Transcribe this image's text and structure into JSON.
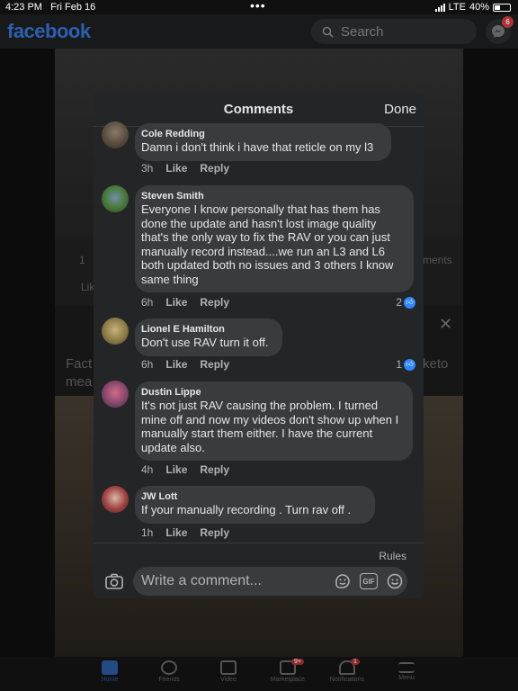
{
  "status_bar": {
    "time": "4:23 PM",
    "date": "Fri Feb 16",
    "carrier": "LTE",
    "battery": "40%",
    "battery_level": 0.4
  },
  "header": {
    "logo": "facebook",
    "search_placeholder": "Search",
    "messenger_badge": "6"
  },
  "background": {
    "snippet_1": "Fact",
    "snippet_2": "mea",
    "snippet_3": "keto",
    "snippet_4": "ments",
    "snippet_5": "Lik",
    "reaction_count": "1"
  },
  "modal": {
    "title": "Comments",
    "done_label": "Done",
    "comments": [
      {
        "name": "Cole Redding",
        "text": "Damn i don't think i have that reticle on my l3",
        "time": "3h",
        "like": "Like",
        "reply": "Reply",
        "reactions": ""
      },
      {
        "name": "Steven Smith",
        "text": "Everyone I know personally that has them has done the update and hasn't lost image quality that's the only way to fix the RAV or you can just manually record instead....we run an L3 and L6 both updated both no issues and 3 others I know same thing",
        "time": "6h",
        "like": "Like",
        "reply": "Reply",
        "reactions": "2"
      },
      {
        "name": "Lionel E Hamilton",
        "text": "Don't use RAV turn it off.",
        "time": "6h",
        "like": "Like",
        "reply": "Reply",
        "reactions": "1"
      },
      {
        "name": "Dustin Lippe",
        "text": "It's not just RAV causing the problem. I turned mine off and now my videos don't show up when I manually start them either. I have the current update also.",
        "time": "4h",
        "like": "Like",
        "reply": "Reply",
        "reactions": ""
      },
      {
        "name": "JW Lott",
        "text": "If your manually recording .   Turn rav off .",
        "time": "1h",
        "like": "Like",
        "reply": "Reply",
        "reactions": ""
      }
    ],
    "rules_label": "Rules",
    "comment_placeholder": "Write a comment...",
    "gif_label": "GIF"
  },
  "bottom_nav": {
    "items": [
      {
        "label": "Home",
        "badge": ""
      },
      {
        "label": "Friends",
        "badge": ""
      },
      {
        "label": "Video",
        "badge": ""
      },
      {
        "label": "Marketplace",
        "badge": "9+"
      },
      {
        "label": "Notifications",
        "badge": "1"
      },
      {
        "label": "Menu",
        "badge": ""
      }
    ]
  },
  "colors": {
    "accent": "#2d88ff",
    "modal_bg": "#242526",
    "bubble_bg": "#3a3b3c"
  }
}
